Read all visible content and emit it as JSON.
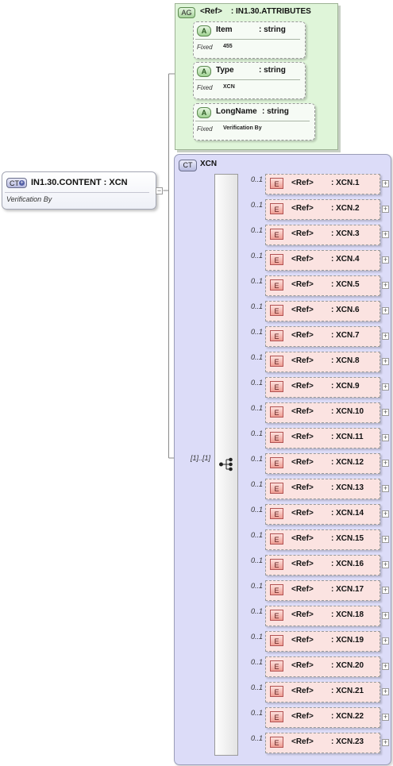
{
  "root": {
    "badge": "CT",
    "title": "IN1.30.CONTENT : XCN",
    "annotation": "Verification By"
  },
  "attribute_group": {
    "badge": "AG",
    "title": "<Ref>    : IN1.30.ATTRIBUTES",
    "attributes": [
      {
        "badge": "A",
        "name": "Item",
        "type": ": string",
        "fixed_label": "Fixed",
        "fixed_value": "455"
      },
      {
        "badge": "A",
        "name": "Type",
        "type": ": string",
        "fixed_label": "Fixed",
        "fixed_value": "XCN"
      },
      {
        "badge": "A",
        "name": "LongName",
        "type": ": string",
        "fixed_label": "Fixed",
        "fixed_value": "Verification By"
      }
    ]
  },
  "complex_type": {
    "badge": "CT",
    "title": "XCN",
    "sequence_occurrence": "[1]..[1]",
    "elements": [
      {
        "occurrence": "0..1",
        "badge": "E",
        "ref": "<Ref>",
        "type": ": XCN.1"
      },
      {
        "occurrence": "0..1",
        "badge": "E",
        "ref": "<Ref>",
        "type": ": XCN.2"
      },
      {
        "occurrence": "0..1",
        "badge": "E",
        "ref": "<Ref>",
        "type": ": XCN.3"
      },
      {
        "occurrence": "0..1",
        "badge": "E",
        "ref": "<Ref>",
        "type": ": XCN.4"
      },
      {
        "occurrence": "0..1",
        "badge": "E",
        "ref": "<Ref>",
        "type": ": XCN.5"
      },
      {
        "occurrence": "0..1",
        "badge": "E",
        "ref": "<Ref>",
        "type": ": XCN.6"
      },
      {
        "occurrence": "0..1",
        "badge": "E",
        "ref": "<Ref>",
        "type": ": XCN.7"
      },
      {
        "occurrence": "0..1",
        "badge": "E",
        "ref": "<Ref>",
        "type": ": XCN.8"
      },
      {
        "occurrence": "0..1",
        "badge": "E",
        "ref": "<Ref>",
        "type": ": XCN.9"
      },
      {
        "occurrence": "0..1",
        "badge": "E",
        "ref": "<Ref>",
        "type": ": XCN.10"
      },
      {
        "occurrence": "0..1",
        "badge": "E",
        "ref": "<Ref>",
        "type": ": XCN.11"
      },
      {
        "occurrence": "0..1",
        "badge": "E",
        "ref": "<Ref>",
        "type": ": XCN.12"
      },
      {
        "occurrence": "0..1",
        "badge": "E",
        "ref": "<Ref>",
        "type": ": XCN.13"
      },
      {
        "occurrence": "0..1",
        "badge": "E",
        "ref": "<Ref>",
        "type": ": XCN.14"
      },
      {
        "occurrence": "0..1",
        "badge": "E",
        "ref": "<Ref>",
        "type": ": XCN.15"
      },
      {
        "occurrence": "0..1",
        "badge": "E",
        "ref": "<Ref>",
        "type": ": XCN.16"
      },
      {
        "occurrence": "0..1",
        "badge": "E",
        "ref": "<Ref>",
        "type": ": XCN.17"
      },
      {
        "occurrence": "0..1",
        "badge": "E",
        "ref": "<Ref>",
        "type": ": XCN.18"
      },
      {
        "occurrence": "0..1",
        "badge": "E",
        "ref": "<Ref>",
        "type": ": XCN.19"
      },
      {
        "occurrence": "0..1",
        "badge": "E",
        "ref": "<Ref>",
        "type": ": XCN.20"
      },
      {
        "occurrence": "0..1",
        "badge": "E",
        "ref": "<Ref>",
        "type": ": XCN.21"
      },
      {
        "occurrence": "0..1",
        "badge": "E",
        "ref": "<Ref>",
        "type": ": XCN.22"
      },
      {
        "occurrence": "0..1",
        "badge": "E",
        "ref": "<Ref>",
        "type": ": XCN.23"
      }
    ]
  },
  "icons": {
    "expander": "plus-box-icon",
    "sequence": "sequence-compositor-icon"
  },
  "colors": {
    "attribute_group_bg": "#dff5d9",
    "complex_type_bg": "#dcdcf8",
    "element_bg": "#fbe3e1",
    "element_badge": "#ef9e94"
  }
}
